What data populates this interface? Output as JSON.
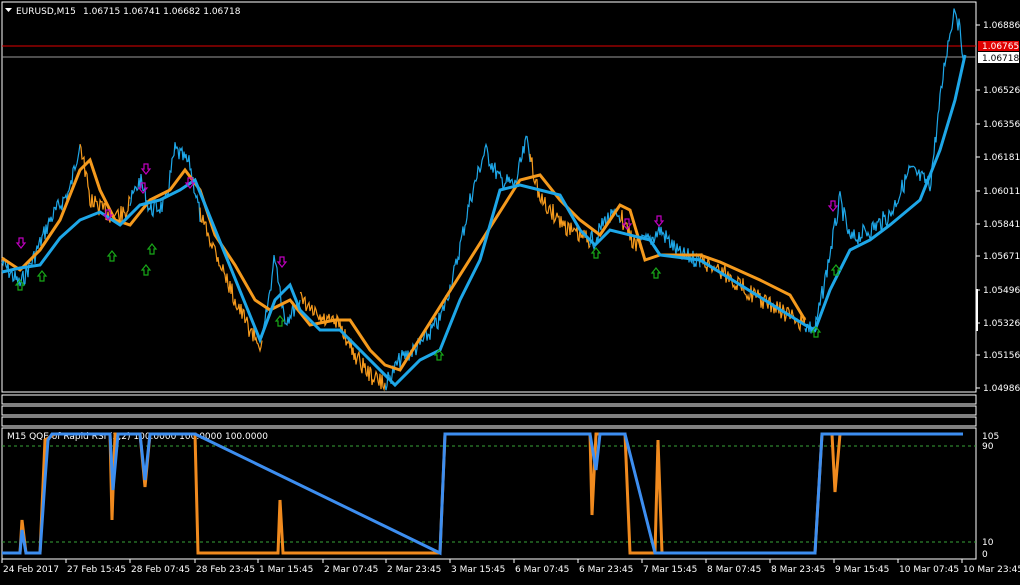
{
  "main_chart": {
    "symbol": "EURUSD,M15",
    "ohlc": "1.06715 1.06741 1.06682 1.06718",
    "price_axis": [
      "1.06886",
      "1.06526",
      "1.06356",
      "1.06181",
      "1.06011",
      "1.05841",
      "1.05671",
      "1.05496",
      "1.05326",
      "1.05156",
      "1.04986"
    ],
    "red_line_label": "1.06765",
    "bid_label": "1.06718"
  },
  "indicator": {
    "title": "M15 QQE of Rapid RSI (2,2) 100.0000 100.0000 100.0000",
    "levels": [
      "105",
      "90",
      "10",
      "0"
    ],
    "level_values": [
      105,
      90,
      10,
      0
    ]
  },
  "time_axis": [
    "24 Feb 2017",
    "27 Feb 15:45",
    "28 Feb 07:45",
    "28 Feb 23:45",
    "1 Mar 15:45",
    "2 Mar 07:45",
    "2 Mar 23:45",
    "3 Mar 15:45",
    "6 Mar 07:45",
    "6 Mar 23:45",
    "7 Mar 15:45",
    "8 Mar 07:45",
    "8 Mar 23:45",
    "9 Mar 15:45",
    "10 Mar 07:45",
    "10 Mar 23:45"
  ],
  "colors": {
    "background": "#000000",
    "axis": "#ffffff",
    "bull": "#1ea7e8",
    "bear": "#f59a1d",
    "price_red_line": "#e00000",
    "up_arrow": "#18a818",
    "down_arrow": "#c000c0",
    "level_line": "#39a339",
    "qqe_blue": "#3d8ef0",
    "qqe_orange": "#f08a1e"
  }
}
